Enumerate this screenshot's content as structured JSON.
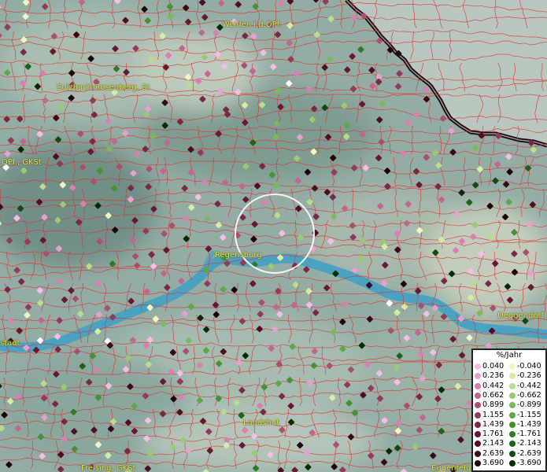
{
  "towns": [
    {
      "name": "Weiden i.d.OPf."
    },
    {
      "name": "Sulzbach-Rosenberg, St"
    },
    {
      "name": "OPf., GKSt"
    },
    {
      "name": "Regensburg"
    },
    {
      "name": "Deggendorf,"
    },
    {
      "name": "stadt"
    },
    {
      "name": "Landshut"
    },
    {
      "name": "Freising, GKSt"
    },
    {
      "name": "Eggenfeld"
    }
  ],
  "legend": {
    "title": "%/Jahr",
    "positive": [
      {
        "value": "0.040",
        "color": "#f6bde6"
      },
      {
        "value": "0.236",
        "color": "#e8a0cf"
      },
      {
        "value": "0.442",
        "color": "#d880b2"
      },
      {
        "value": "0.662",
        "color": "#c06690"
      },
      {
        "value": "0.899",
        "color": "#a9506f"
      },
      {
        "value": "1.155",
        "color": "#923a59"
      },
      {
        "value": "1.439",
        "color": "#7a2844"
      },
      {
        "value": "1.761",
        "color": "#651a34"
      },
      {
        "value": "2.143",
        "color": "#4e0f25"
      },
      {
        "value": "2.639",
        "color": "#3a0818"
      },
      {
        "value": "3.690",
        "color": "#1f020a"
      }
    ],
    "negative": [
      {
        "value": "-0.040",
        "color": "#eef8c0"
      },
      {
        "value": "-0.236",
        "color": "#d6eea4"
      },
      {
        "value": "-0.442",
        "color": "#b7de8c"
      },
      {
        "value": "-0.662",
        "color": "#98cc72"
      },
      {
        "value": "-0.899",
        "color": "#7bb95c"
      },
      {
        "value": "-1.155",
        "color": "#5ea648"
      },
      {
        "value": "-1.439",
        "color": "#449234"
      },
      {
        "value": "-1.761",
        "color": "#2e7b24"
      },
      {
        "value": "-2.143",
        "color": "#1d6318"
      },
      {
        "value": "-2.639",
        "color": "#0f4a0e"
      },
      {
        "value": "-3.690",
        "color": "#052c05"
      }
    ]
  },
  "colors": {
    "boundary": "#e03030",
    "river": "#3d9fc6",
    "border": "#1a1010",
    "label": "#e8e84a",
    "white_point": "#ffffff"
  }
}
